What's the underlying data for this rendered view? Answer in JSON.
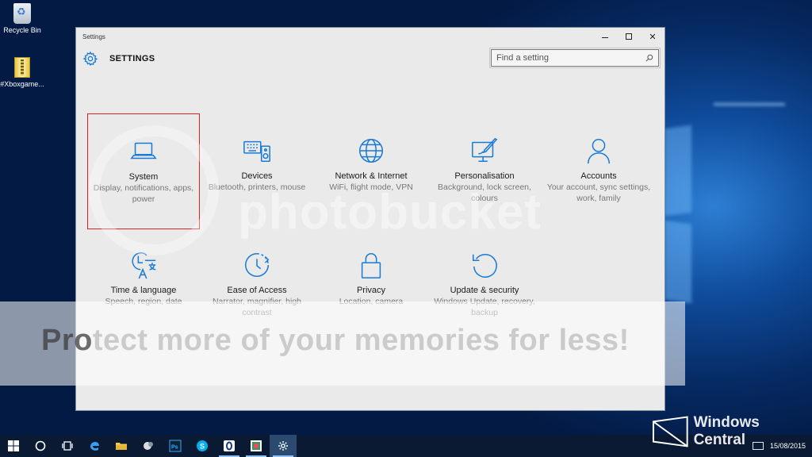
{
  "desktop": {
    "icons": [
      {
        "label": "Recycle Bin"
      },
      {
        "label": "#Xboxgame..."
      }
    ]
  },
  "window": {
    "title": "Settings",
    "heading": "SETTINGS",
    "search": {
      "placeholder": "Find a setting"
    }
  },
  "tiles": [
    {
      "icon": "laptop-icon",
      "name": "System",
      "desc": "Display, notifications, apps, power",
      "selected": true
    },
    {
      "icon": "keyboard-speaker-icon",
      "name": "Devices",
      "desc": "Bluetooth, printers, mouse"
    },
    {
      "icon": "globe-icon",
      "name": "Network & Internet",
      "desc": "WiFi, flight mode, VPN"
    },
    {
      "icon": "paint-screen-icon",
      "name": "Personalisation",
      "desc": "Background, lock screen, colours"
    },
    {
      "icon": "person-icon",
      "name": "Accounts",
      "desc": "Your account, sync settings, work, family"
    },
    {
      "icon": "clock-language-icon",
      "name": "Time & language",
      "desc": "Speech, region, date"
    },
    {
      "icon": "ease-of-access-icon",
      "name": "Ease of Access",
      "desc": "Narrator, magnifier, high contrast"
    },
    {
      "icon": "lock-icon",
      "name": "Privacy",
      "desc": "Location, camera"
    },
    {
      "icon": "update-arrows-icon",
      "name": "Update & security",
      "desc": "Windows Update, recovery, backup"
    }
  ],
  "watermark": {
    "logo": "photobucket",
    "band_text_first": "Pro",
    "band_text_rest": "tect more of your memories for less!"
  },
  "taskbar": {
    "items": [
      "start-icon",
      "cortana-icon",
      "task-view-icon",
      "edge-icon",
      "file-explorer-icon",
      "media-icon",
      "photoshop-icon",
      "skype-icon",
      "opera-icon",
      "tweetdeck-icon",
      "settings-icon"
    ],
    "clock_date": "15/08/2015"
  },
  "brand": {
    "text": "Windows Central"
  },
  "colors": {
    "accent": "#1a7bd6",
    "selection": "#e02020"
  }
}
